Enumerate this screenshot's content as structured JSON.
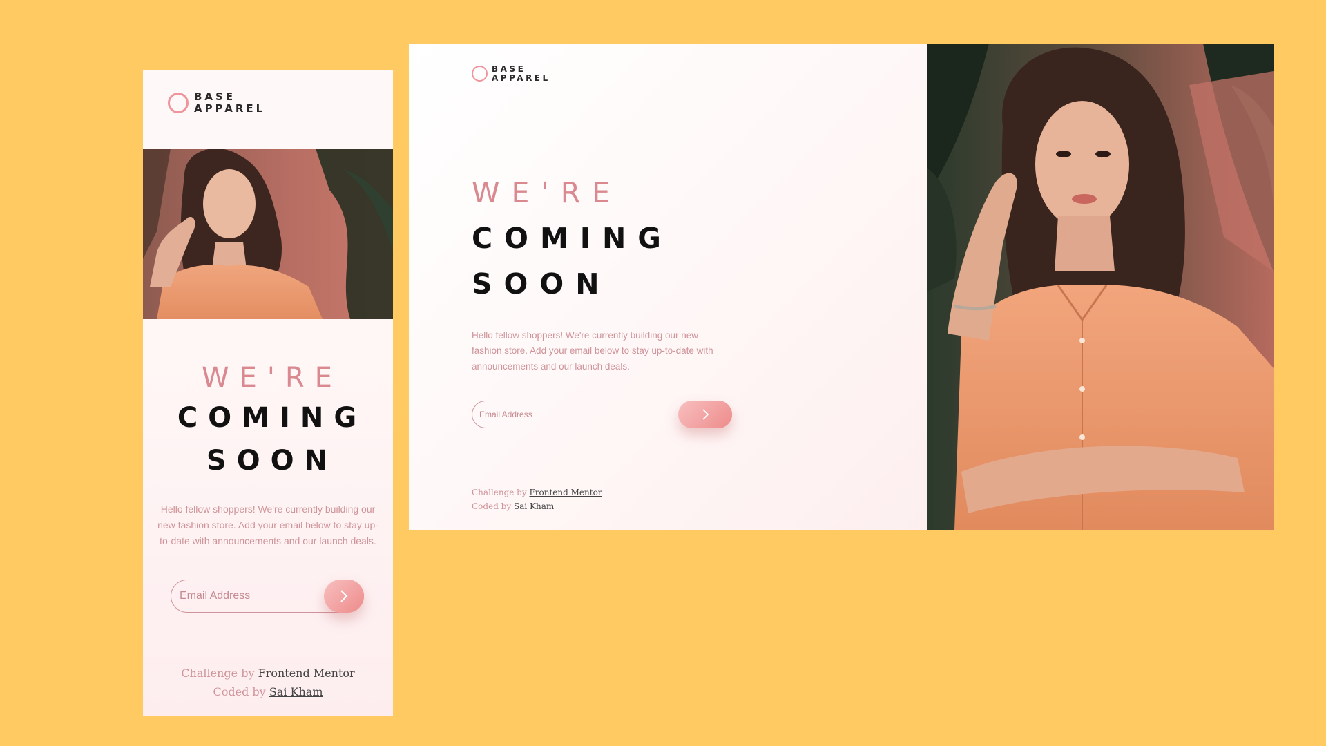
{
  "brand": {
    "line1": "BASE",
    "line2": "APPAREL"
  },
  "headline": {
    "light": "WE'RE",
    "line2": "COMING",
    "line3": "SOON"
  },
  "description": "Hello fellow shoppers! We're currently building our new fashion store. Add your email below to stay up-to-date with announcements and our launch deals.",
  "form": {
    "email_placeholder": "Email Address",
    "submit_icon": "chevron-right-icon"
  },
  "credits": {
    "challenge_prefix": "Challenge by",
    "challenge_link": "Frontend Mentor",
    "coded_prefix": "Coded by",
    "coded_link": "Sai Kham"
  },
  "colors": {
    "background": "#FFCA62",
    "accent": "#CE9499",
    "button_start": "#F8BFBF",
    "button_end": "#EE8B8B",
    "heading_dark": "#111111"
  },
  "images": {
    "hero_photo": "woman-in-orange-shirt-photo"
  }
}
